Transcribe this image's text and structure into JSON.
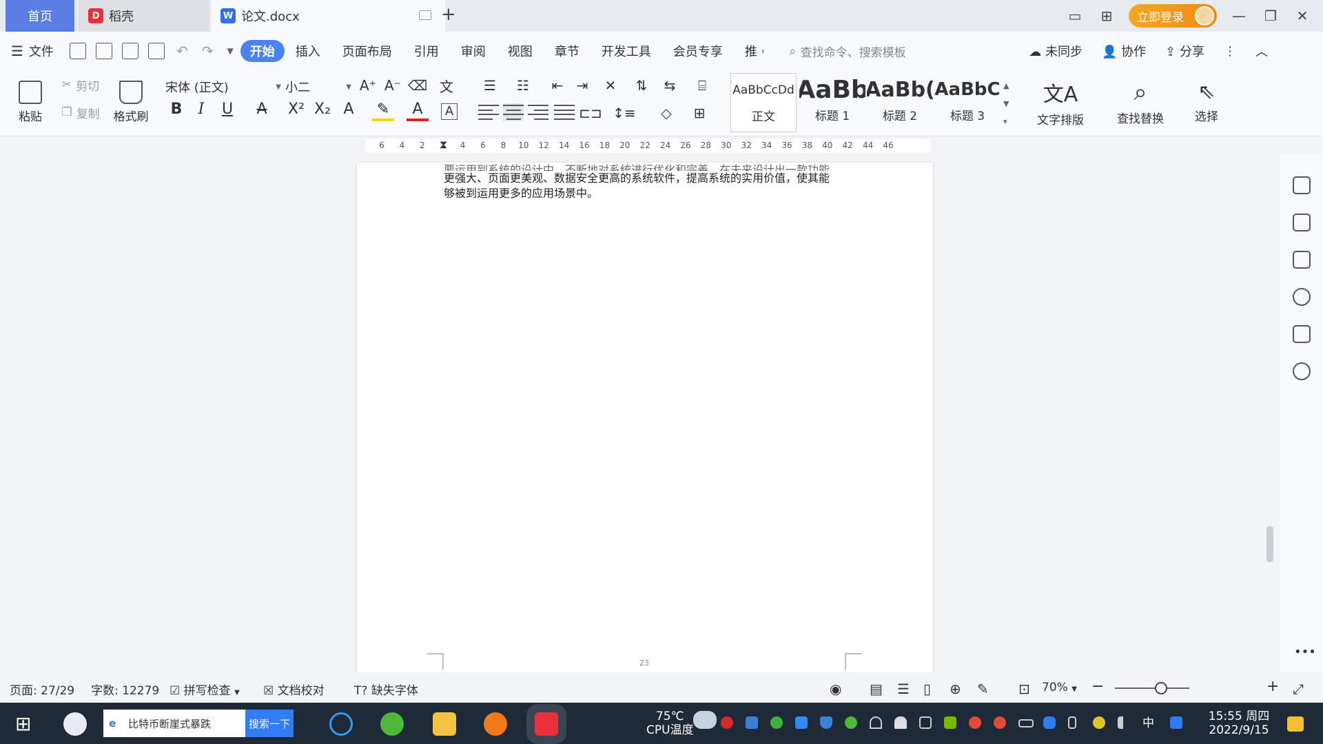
{
  "tabs": {
    "home": "首页",
    "daoke": "稻壳",
    "doc": "论文.docx",
    "new_tab": "+"
  },
  "window": {
    "login": "立即登录"
  },
  "menu": {
    "file": "文件",
    "items": [
      "开始",
      "插入",
      "页面布局",
      "引用",
      "审阅",
      "视图",
      "章节",
      "开发工具",
      "会员专享",
      "推"
    ],
    "search_placeholder": "查找命令、搜索模板",
    "sync": "未同步",
    "collab": "协作",
    "share": "分享"
  },
  "ribbon": {
    "paste": "粘贴",
    "cut": "剪切",
    "copy": "复制",
    "format_painter": "格式刷",
    "font": "宋体 (正文)",
    "size": "小二",
    "styles": [
      {
        "sample": "AaBbCcDd",
        "name": "正文"
      },
      {
        "sample": "AaBb",
        "name": "标题 1"
      },
      {
        "sample": "AaBb(",
        "name": "标题 2"
      },
      {
        "sample": "AaBbC",
        "name": "标题 3"
      }
    ],
    "text_layout": "文字排版",
    "find_replace": "查找替换",
    "select": "选择"
  },
  "ruler": {
    "ticks": [
      "6",
      "4",
      "2",
      "2",
      "4",
      "6",
      "8",
      "10",
      "12",
      "14",
      "16",
      "18",
      "20",
      "22",
      "24",
      "26",
      "28",
      "30",
      "32",
      "34",
      "36",
      "38",
      "40",
      "42",
      "44",
      "46"
    ]
  },
  "document": {
    "line1": "更强大、页面更美观、数据安全更高的系统软件，提高系统的实用价值，使其能",
    "line2": "够被到运用更多的应用场景中。",
    "partial_line": "要运用到系统的设计中，不断地对系统进行优化和完善，在未来设计出一款功能",
    "page_number": "23"
  },
  "status": {
    "page": "页面: 27/29",
    "words": "字数: 12279",
    "spell": "拼写检查",
    "proof": "文档校对",
    "missing_font": "缺失字体",
    "zoom": "70%"
  },
  "taskbar": {
    "search_text": "比特币断崖式暴跌",
    "search_button": "搜索一下",
    "temp": "75℃",
    "temp_label": "CPU温度",
    "ime": "中",
    "time": "15:55 周四",
    "date": "2022/9/15"
  },
  "colors": {
    "accent": "#4a83ef",
    "home_tab": "#5b7ee5",
    "login": "#f5a623",
    "taskbar": "#1f2a38"
  }
}
